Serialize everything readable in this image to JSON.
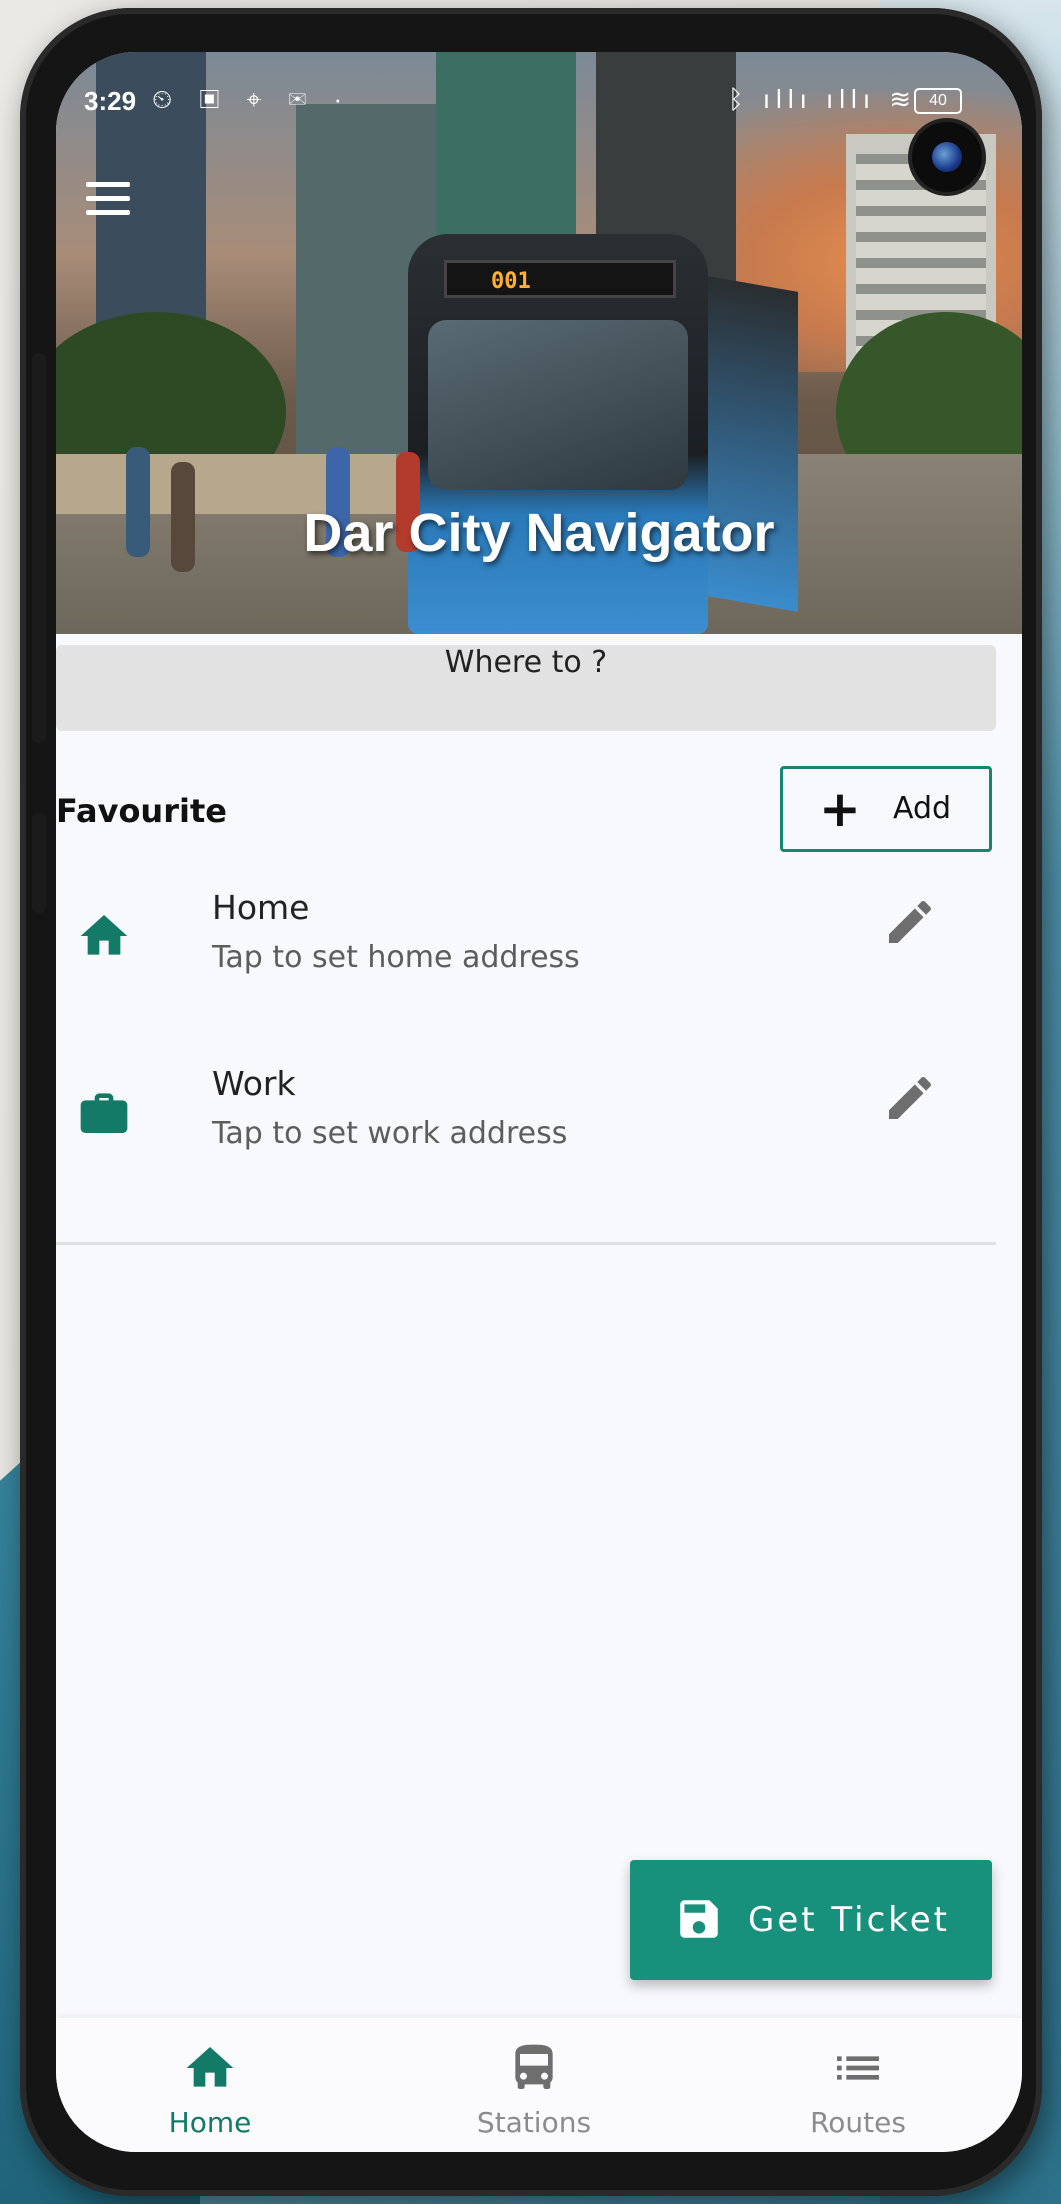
{
  "status_bar": {
    "time": "3:29",
    "left_icons": "⏲ ▣ ⌖ ✉ ·",
    "right_icons": "ᛒ ıllı ıllı ≋",
    "battery": "40"
  },
  "header": {
    "title": "Dar City Navigator",
    "bus_sign": "001"
  },
  "search": {
    "placeholder": "Where to ?"
  },
  "favourites": {
    "title": "Favourite",
    "add_label": "Add",
    "items": [
      {
        "name": "Home",
        "subtitle": "Tap to set home address",
        "icon": "home-icon"
      },
      {
        "name": "Work",
        "subtitle": "Tap to set work address",
        "icon": "briefcase-icon"
      }
    ]
  },
  "ticket_button": {
    "label": "Get Ticket",
    "icon": "save-icon"
  },
  "bottom_nav": {
    "items": [
      {
        "label": "Home",
        "icon": "home-icon",
        "active": true
      },
      {
        "label": "Stations",
        "icon": "bus-icon",
        "active": false
      },
      {
        "label": "Routes",
        "icon": "list-icon",
        "active": false
      }
    ]
  },
  "colors": {
    "accent": "#17856f",
    "active_nav": "#137a68",
    "inactive_nav": "#8c8c8c",
    "ticket_button": "#17917c"
  }
}
